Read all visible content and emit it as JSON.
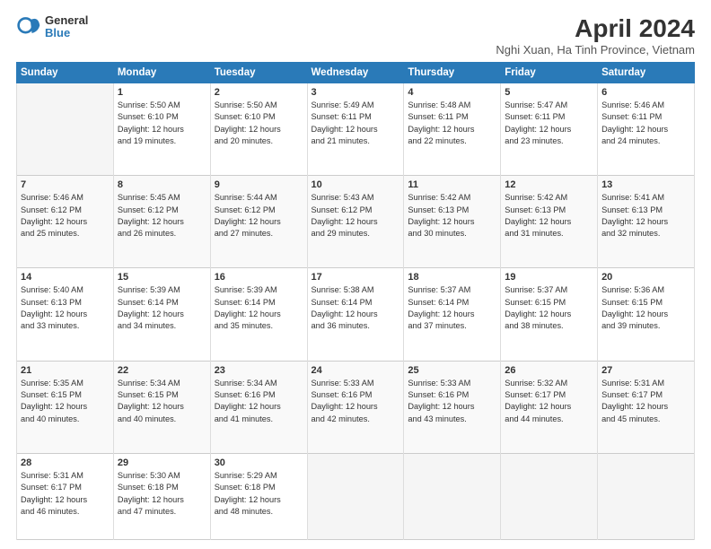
{
  "logo": {
    "general": "General",
    "blue": "Blue"
  },
  "title": "April 2024",
  "subtitle": "Nghi Xuan, Ha Tinh Province, Vietnam",
  "days_header": [
    "Sunday",
    "Monday",
    "Tuesday",
    "Wednesday",
    "Thursday",
    "Friday",
    "Saturday"
  ],
  "weeks": [
    [
      {
        "num": "",
        "info": ""
      },
      {
        "num": "1",
        "info": "Sunrise: 5:50 AM\nSunset: 6:10 PM\nDaylight: 12 hours\nand 19 minutes."
      },
      {
        "num": "2",
        "info": "Sunrise: 5:50 AM\nSunset: 6:10 PM\nDaylight: 12 hours\nand 20 minutes."
      },
      {
        "num": "3",
        "info": "Sunrise: 5:49 AM\nSunset: 6:11 PM\nDaylight: 12 hours\nand 21 minutes."
      },
      {
        "num": "4",
        "info": "Sunrise: 5:48 AM\nSunset: 6:11 PM\nDaylight: 12 hours\nand 22 minutes."
      },
      {
        "num": "5",
        "info": "Sunrise: 5:47 AM\nSunset: 6:11 PM\nDaylight: 12 hours\nand 23 minutes."
      },
      {
        "num": "6",
        "info": "Sunrise: 5:46 AM\nSunset: 6:11 PM\nDaylight: 12 hours\nand 24 minutes."
      }
    ],
    [
      {
        "num": "7",
        "info": "Sunrise: 5:46 AM\nSunset: 6:12 PM\nDaylight: 12 hours\nand 25 minutes."
      },
      {
        "num": "8",
        "info": "Sunrise: 5:45 AM\nSunset: 6:12 PM\nDaylight: 12 hours\nand 26 minutes."
      },
      {
        "num": "9",
        "info": "Sunrise: 5:44 AM\nSunset: 6:12 PM\nDaylight: 12 hours\nand 27 minutes."
      },
      {
        "num": "10",
        "info": "Sunrise: 5:43 AM\nSunset: 6:12 PM\nDaylight: 12 hours\nand 29 minutes."
      },
      {
        "num": "11",
        "info": "Sunrise: 5:42 AM\nSunset: 6:13 PM\nDaylight: 12 hours\nand 30 minutes."
      },
      {
        "num": "12",
        "info": "Sunrise: 5:42 AM\nSunset: 6:13 PM\nDaylight: 12 hours\nand 31 minutes."
      },
      {
        "num": "13",
        "info": "Sunrise: 5:41 AM\nSunset: 6:13 PM\nDaylight: 12 hours\nand 32 minutes."
      }
    ],
    [
      {
        "num": "14",
        "info": "Sunrise: 5:40 AM\nSunset: 6:13 PM\nDaylight: 12 hours\nand 33 minutes."
      },
      {
        "num": "15",
        "info": "Sunrise: 5:39 AM\nSunset: 6:14 PM\nDaylight: 12 hours\nand 34 minutes."
      },
      {
        "num": "16",
        "info": "Sunrise: 5:39 AM\nSunset: 6:14 PM\nDaylight: 12 hours\nand 35 minutes."
      },
      {
        "num": "17",
        "info": "Sunrise: 5:38 AM\nSunset: 6:14 PM\nDaylight: 12 hours\nand 36 minutes."
      },
      {
        "num": "18",
        "info": "Sunrise: 5:37 AM\nSunset: 6:14 PM\nDaylight: 12 hours\nand 37 minutes."
      },
      {
        "num": "19",
        "info": "Sunrise: 5:37 AM\nSunset: 6:15 PM\nDaylight: 12 hours\nand 38 minutes."
      },
      {
        "num": "20",
        "info": "Sunrise: 5:36 AM\nSunset: 6:15 PM\nDaylight: 12 hours\nand 39 minutes."
      }
    ],
    [
      {
        "num": "21",
        "info": "Sunrise: 5:35 AM\nSunset: 6:15 PM\nDaylight: 12 hours\nand 40 minutes."
      },
      {
        "num": "22",
        "info": "Sunrise: 5:34 AM\nSunset: 6:15 PM\nDaylight: 12 hours\nand 40 minutes."
      },
      {
        "num": "23",
        "info": "Sunrise: 5:34 AM\nSunset: 6:16 PM\nDaylight: 12 hours\nand 41 minutes."
      },
      {
        "num": "24",
        "info": "Sunrise: 5:33 AM\nSunset: 6:16 PM\nDaylight: 12 hours\nand 42 minutes."
      },
      {
        "num": "25",
        "info": "Sunrise: 5:33 AM\nSunset: 6:16 PM\nDaylight: 12 hours\nand 43 minutes."
      },
      {
        "num": "26",
        "info": "Sunrise: 5:32 AM\nSunset: 6:17 PM\nDaylight: 12 hours\nand 44 minutes."
      },
      {
        "num": "27",
        "info": "Sunrise: 5:31 AM\nSunset: 6:17 PM\nDaylight: 12 hours\nand 45 minutes."
      }
    ],
    [
      {
        "num": "28",
        "info": "Sunrise: 5:31 AM\nSunset: 6:17 PM\nDaylight: 12 hours\nand 46 minutes."
      },
      {
        "num": "29",
        "info": "Sunrise: 5:30 AM\nSunset: 6:18 PM\nDaylight: 12 hours\nand 47 minutes."
      },
      {
        "num": "30",
        "info": "Sunrise: 5:29 AM\nSunset: 6:18 PM\nDaylight: 12 hours\nand 48 minutes."
      },
      {
        "num": "",
        "info": ""
      },
      {
        "num": "",
        "info": ""
      },
      {
        "num": "",
        "info": ""
      },
      {
        "num": "",
        "info": ""
      }
    ]
  ]
}
